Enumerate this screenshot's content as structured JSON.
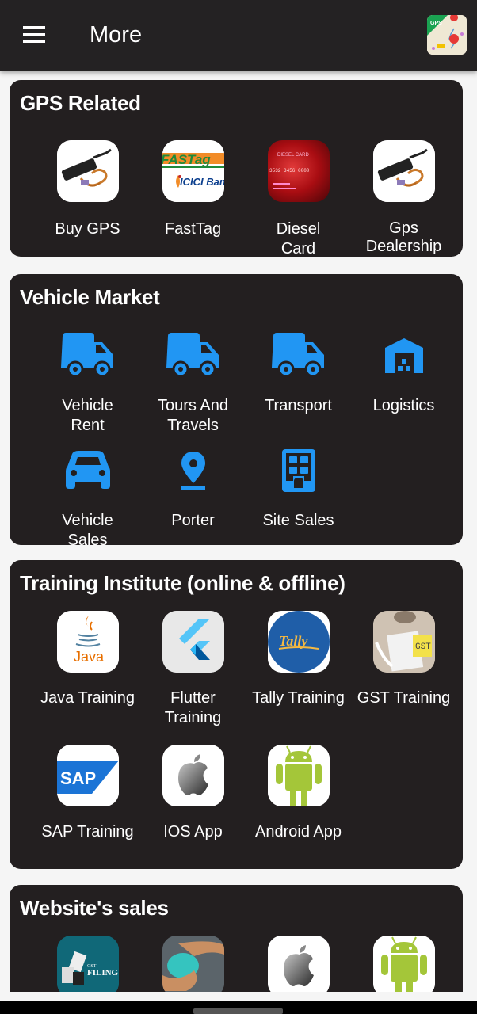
{
  "appbar": {
    "title": "More",
    "menu_icon": "hamburger-menu-icon",
    "logo": "gps-map-app-logo"
  },
  "sections": [
    {
      "title": "GPS Related",
      "items": [
        {
          "label": "Buy GPS",
          "icon": "gps-tracker-device-image"
        },
        {
          "label": "FastTag",
          "icon": "fastag-icici-image"
        },
        {
          "label": "Diesel Card",
          "icon": "diesel-card-image"
        },
        {
          "label": "Gps Dealership",
          "icon": "gps-tracker-device-image"
        }
      ]
    },
    {
      "title": "Vehicle Market",
      "icon_color": "#2196f3",
      "items": [
        {
          "label": "Vehicle Rent",
          "icon": "truck-icon"
        },
        {
          "label": "Tours And Travels",
          "icon": "truck-icon"
        },
        {
          "label": "Transport",
          "icon": "truck-icon"
        },
        {
          "label": "Logistics",
          "icon": "warehouse-icon"
        },
        {
          "label": "Vehicle Sales",
          "icon": "car-icon"
        },
        {
          "label": "Porter",
          "icon": "location-pin-icon"
        },
        {
          "label": "Site Sales",
          "icon": "building-icon"
        }
      ]
    },
    {
      "title": "Training Institute (online & offline)",
      "items": [
        {
          "label": "Java Training",
          "icon": "java-logo"
        },
        {
          "label": "Flutter Training",
          "icon": "flutter-logo"
        },
        {
          "label": "Tally Training",
          "icon": "tally-logo"
        },
        {
          "label": "GST Training",
          "icon": "gst-image"
        },
        {
          "label": "SAP Training",
          "icon": "sap-logo"
        },
        {
          "label": "IOS App",
          "icon": "apple-logo"
        },
        {
          "label": "Android App",
          "icon": "android-logo"
        }
      ]
    },
    {
      "title": "Website's sales",
      "items": [
        {
          "label": "",
          "icon": "gst-filing-image",
          "image_text": "GST",
          "image_text2": "FILING"
        },
        {
          "label": "",
          "icon": "data-hands-image"
        },
        {
          "label": "",
          "icon": "apple-logo"
        },
        {
          "label": "",
          "icon": "android-logo"
        }
      ]
    }
  ],
  "image_text": {
    "fastag": "FASTag",
    "icici": "ICICI Bank",
    "diesel_card": "DIESEL CARD",
    "card_number": "3532 3456 0000",
    "java": "Java",
    "tally": "Tally",
    "gst": "GST",
    "sap": "SAP",
    "gps": "GPS"
  }
}
